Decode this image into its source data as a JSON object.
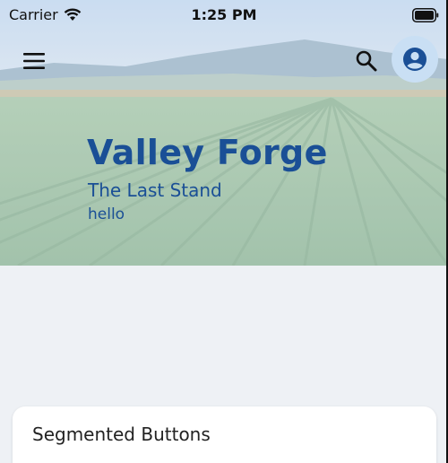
{
  "status_bar": {
    "carrier": "Carrier",
    "time": "1:25 PM",
    "icons": [
      "wifi-icon",
      "battery-icon"
    ]
  },
  "app_bar": {
    "menu_icon": "hamburger-menu-icon",
    "search_icon": "search-icon",
    "avatar_icon": "account-circle-icon"
  },
  "hero": {
    "title": "Valley Forge",
    "subtitle": "The Last Stand",
    "caption": "hello"
  },
  "card": {
    "title": "Segmented Buttons"
  },
  "colors": {
    "hero_text": "#1a4f96",
    "avatar_bg": "#c9dff4",
    "page_bg": "#eef1f5",
    "card_bg": "#ffffff"
  }
}
